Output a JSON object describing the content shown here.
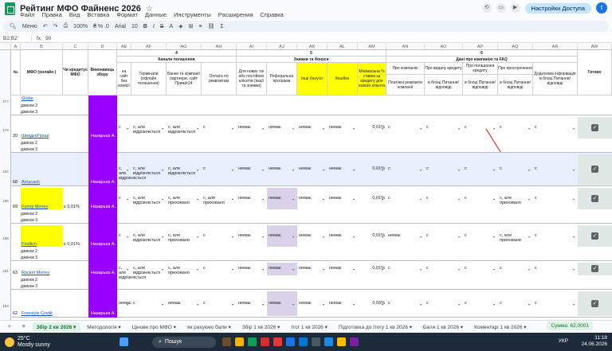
{
  "app": {
    "title": "Рейтинг МФО Файненс 2026",
    "menu": [
      "Файл",
      "Правка",
      "Вид",
      "Вставка",
      "Формат",
      "Данные",
      "Инструменты",
      "Расширения",
      "Справка"
    ],
    "share": "Настройки Доступа",
    "avatar": "t"
  },
  "toolbar": {
    "search": "Меню",
    "zoom": "100%",
    "font": "Arial",
    "size": "10"
  },
  "formula": {
    "ref": "B2:B2",
    "value": "90"
  },
  "columns": [
    "A",
    "B",
    "C",
    "D",
    "AE",
    "AF",
    "AG",
    "AH",
    "AI",
    "AJ",
    "AK",
    "AL",
    "AM",
    "AN",
    "AO",
    "AP",
    "AQ",
    "AR",
    "AW"
  ],
  "headers": {
    "num": "№",
    "mfo": "МФО (онлайн )",
    "credit": "Чи кредитує МФО",
    "executor": "Виконавець збору",
    "channels": "Канали погашення",
    "channels_n": "4",
    "bonuses": "Знижки та бонуси",
    "bonuses_n": "5",
    "days": "Дані про компанію та FAQ",
    "days_n": "6",
    "c1": "на сайт без комісії",
    "c2": "Термінали (офлайн погашення)",
    "c3": "Банки та компанії партнери, сайт Приват24",
    "c4": "Оплата по реквізитам",
    "b1": "Для нових та/або постійних клієнтів (акції та знижки)",
    "b2": "Реферальна програма",
    "b3": "Інші бонуси",
    "b4": "Кешбек",
    "b5": "Мінімальна % ставка за кредиту для нового клієнта",
    "d1": "Про компанію",
    "d1s": "Платіжні реквізити компанії",
    "d2": "Про видачу кредиту",
    "d2s": "в блоці Питання/відповіді",
    "d3": "Про погашення кредиту",
    "d3s": "в блоці Питання/відповіді",
    "d4": "Про прострочення",
    "d4s": "в блоці Питання/відповіді",
    "d5": "Додаткова інформація в блоці Питання/відповіді",
    "ready": "Готово"
  },
  "rows": [
    {
      "n": "",
      "name": "Globe",
      "sub": [
        "дзвінок 2",
        "дзвінок 3"
      ],
      "row_label": "177",
      "credit": ""
    },
    {
      "n": "20",
      "name": "ШвидкоГроші",
      "row_label": "179",
      "credit": "",
      "executor": "Назарьєв А.",
      "values": [
        "с",
        "с, але відрізняється",
        "с, але відрізняється",
        "с",
        "немає",
        "немає",
        "немає",
        "немає",
        "0,01%",
        "с",
        "с",
        "с",
        "с",
        "с"
      ],
      "sub": [
        "дзвінок 2",
        "дзвінок 3"
      ]
    },
    {
      "n": "68",
      "name": "Avracash",
      "row_label": "182",
      "credit": "",
      "executor": "Назарьєв А.",
      "values": [
        "с, але відрізняється",
        "с, але відрізняється",
        "с, але відрізняється",
        "с",
        "немає",
        "немає",
        "немає",
        "немає",
        "0,01%",
        "с",
        "с",
        "с",
        "с",
        "с"
      ]
    },
    {
      "n": "69",
      "name": "Funny Money",
      "row_label": "185",
      "credit": "є 0,01%",
      "executor": "Назарьєв А.",
      "values": [
        "с",
        "с, але відрізняється",
        "с, але приховано",
        "с, але приховано",
        "немає",
        "немає",
        "немає",
        "немає",
        "0,01%",
        "с",
        "с",
        "с",
        "с, але приховано",
        "с"
      ],
      "sub": [
        "дзвінок 2",
        "дзвінок 3"
      ]
    },
    {
      "n": "",
      "name": "Findlich",
      "row_label": "188",
      "credit": "є 0,01%",
      "executor": "Назарьєв А.",
      "values": [
        "с",
        "с, але відрізняється",
        "с, але приховано",
        "с",
        "немає",
        "немає",
        "немає",
        "немає",
        "0,01%",
        "немає",
        "с",
        "с",
        "с, але приховано",
        "с"
      ],
      "sub": [
        "дзвінок 2",
        "дзвінок 3"
      ]
    },
    {
      "n": "63",
      "name": "Rocket Money",
      "row_label": "191",
      "credit": "",
      "executor": "Назарьєв А.",
      "values": [
        "с, але відрізняється",
        "с, але відрізняється",
        "с, але приховано",
        "с",
        "немає",
        "немає",
        "немає",
        "немає",
        "0,01%",
        "с",
        "с",
        "с",
        "с",
        "с"
      ],
      "sub": [
        "дзвінок 2",
        "дзвінок 3"
      ]
    },
    {
      "n": "62",
      "name": "Freestyle Credit",
      "row_label": "194",
      "credit": "",
      "executor": "Назарьєв А.",
      "values": [
        "немає",
        "с",
        "немає",
        "с",
        "немає",
        "немає",
        "немає",
        "немає",
        "0,50%",
        "с",
        "с",
        "с",
        "с",
        "с"
      ]
    }
  ],
  "tabs": [
    "Збір 2 кв 2026",
    "Методологія",
    "Цінове про МФО",
    "як рахуємо бали",
    "Збір 1 кв 2026",
    "Ітог 1 кв 2026",
    "Підготовка до Ітогу 1 кв 2026",
    "Бали 1 кв 2026",
    "Коментарі 1 кв 2026"
  ],
  "sum": "Сумма: 62,0001",
  "taskbar": {
    "temp": "25°C",
    "weather": "Mostly sunny",
    "search": "Пошук",
    "lang": "УКР",
    "time": "11:18",
    "date": "24.06.2026"
  },
  "colors": {
    "purple": "#9900ff",
    "yellow": "#ffff00",
    "lilac": "#d9d2e9",
    "orange": "#ff9900",
    "arrow": "#e53935"
  }
}
